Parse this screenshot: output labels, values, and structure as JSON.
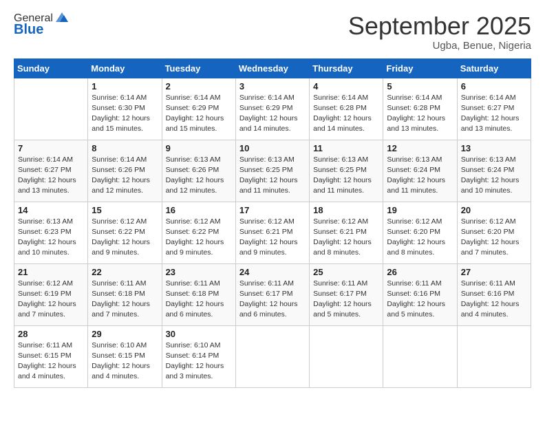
{
  "logo": {
    "general": "General",
    "blue": "Blue"
  },
  "header": {
    "month": "September 2025",
    "location": "Ugba, Benue, Nigeria"
  },
  "days_of_week": [
    "Sunday",
    "Monday",
    "Tuesday",
    "Wednesday",
    "Thursday",
    "Friday",
    "Saturday"
  ],
  "weeks": [
    [
      {
        "day": "",
        "sunrise": "",
        "sunset": "",
        "daylight": ""
      },
      {
        "day": "1",
        "sunrise": "Sunrise: 6:14 AM",
        "sunset": "Sunset: 6:30 PM",
        "daylight": "Daylight: 12 hours and 15 minutes."
      },
      {
        "day": "2",
        "sunrise": "Sunrise: 6:14 AM",
        "sunset": "Sunset: 6:29 PM",
        "daylight": "Daylight: 12 hours and 15 minutes."
      },
      {
        "day": "3",
        "sunrise": "Sunrise: 6:14 AM",
        "sunset": "Sunset: 6:29 PM",
        "daylight": "Daylight: 12 hours and 14 minutes."
      },
      {
        "day": "4",
        "sunrise": "Sunrise: 6:14 AM",
        "sunset": "Sunset: 6:28 PM",
        "daylight": "Daylight: 12 hours and 14 minutes."
      },
      {
        "day": "5",
        "sunrise": "Sunrise: 6:14 AM",
        "sunset": "Sunset: 6:28 PM",
        "daylight": "Daylight: 12 hours and 13 minutes."
      },
      {
        "day": "6",
        "sunrise": "Sunrise: 6:14 AM",
        "sunset": "Sunset: 6:27 PM",
        "daylight": "Daylight: 12 hours and 13 minutes."
      }
    ],
    [
      {
        "day": "7",
        "sunrise": "Sunrise: 6:14 AM",
        "sunset": "Sunset: 6:27 PM",
        "daylight": "Daylight: 12 hours and 13 minutes."
      },
      {
        "day": "8",
        "sunrise": "Sunrise: 6:14 AM",
        "sunset": "Sunset: 6:26 PM",
        "daylight": "Daylight: 12 hours and 12 minutes."
      },
      {
        "day": "9",
        "sunrise": "Sunrise: 6:13 AM",
        "sunset": "Sunset: 6:26 PM",
        "daylight": "Daylight: 12 hours and 12 minutes."
      },
      {
        "day": "10",
        "sunrise": "Sunrise: 6:13 AM",
        "sunset": "Sunset: 6:25 PM",
        "daylight": "Daylight: 12 hours and 11 minutes."
      },
      {
        "day": "11",
        "sunrise": "Sunrise: 6:13 AM",
        "sunset": "Sunset: 6:25 PM",
        "daylight": "Daylight: 12 hours and 11 minutes."
      },
      {
        "day": "12",
        "sunrise": "Sunrise: 6:13 AM",
        "sunset": "Sunset: 6:24 PM",
        "daylight": "Daylight: 12 hours and 11 minutes."
      },
      {
        "day": "13",
        "sunrise": "Sunrise: 6:13 AM",
        "sunset": "Sunset: 6:24 PM",
        "daylight": "Daylight: 12 hours and 10 minutes."
      }
    ],
    [
      {
        "day": "14",
        "sunrise": "Sunrise: 6:13 AM",
        "sunset": "Sunset: 6:23 PM",
        "daylight": "Daylight: 12 hours and 10 minutes."
      },
      {
        "day": "15",
        "sunrise": "Sunrise: 6:12 AM",
        "sunset": "Sunset: 6:22 PM",
        "daylight": "Daylight: 12 hours and 9 minutes."
      },
      {
        "day": "16",
        "sunrise": "Sunrise: 6:12 AM",
        "sunset": "Sunset: 6:22 PM",
        "daylight": "Daylight: 12 hours and 9 minutes."
      },
      {
        "day": "17",
        "sunrise": "Sunrise: 6:12 AM",
        "sunset": "Sunset: 6:21 PM",
        "daylight": "Daylight: 12 hours and 9 minutes."
      },
      {
        "day": "18",
        "sunrise": "Sunrise: 6:12 AM",
        "sunset": "Sunset: 6:21 PM",
        "daylight": "Daylight: 12 hours and 8 minutes."
      },
      {
        "day": "19",
        "sunrise": "Sunrise: 6:12 AM",
        "sunset": "Sunset: 6:20 PM",
        "daylight": "Daylight: 12 hours and 8 minutes."
      },
      {
        "day": "20",
        "sunrise": "Sunrise: 6:12 AM",
        "sunset": "Sunset: 6:20 PM",
        "daylight": "Daylight: 12 hours and 7 minutes."
      }
    ],
    [
      {
        "day": "21",
        "sunrise": "Sunrise: 6:12 AM",
        "sunset": "Sunset: 6:19 PM",
        "daylight": "Daylight: 12 hours and 7 minutes."
      },
      {
        "day": "22",
        "sunrise": "Sunrise: 6:11 AM",
        "sunset": "Sunset: 6:18 PM",
        "daylight": "Daylight: 12 hours and 7 minutes."
      },
      {
        "day": "23",
        "sunrise": "Sunrise: 6:11 AM",
        "sunset": "Sunset: 6:18 PM",
        "daylight": "Daylight: 12 hours and 6 minutes."
      },
      {
        "day": "24",
        "sunrise": "Sunrise: 6:11 AM",
        "sunset": "Sunset: 6:17 PM",
        "daylight": "Daylight: 12 hours and 6 minutes."
      },
      {
        "day": "25",
        "sunrise": "Sunrise: 6:11 AM",
        "sunset": "Sunset: 6:17 PM",
        "daylight": "Daylight: 12 hours and 5 minutes."
      },
      {
        "day": "26",
        "sunrise": "Sunrise: 6:11 AM",
        "sunset": "Sunset: 6:16 PM",
        "daylight": "Daylight: 12 hours and 5 minutes."
      },
      {
        "day": "27",
        "sunrise": "Sunrise: 6:11 AM",
        "sunset": "Sunset: 6:16 PM",
        "daylight": "Daylight: 12 hours and 4 minutes."
      }
    ],
    [
      {
        "day": "28",
        "sunrise": "Sunrise: 6:11 AM",
        "sunset": "Sunset: 6:15 PM",
        "daylight": "Daylight: 12 hours and 4 minutes."
      },
      {
        "day": "29",
        "sunrise": "Sunrise: 6:10 AM",
        "sunset": "Sunset: 6:15 PM",
        "daylight": "Daylight: 12 hours and 4 minutes."
      },
      {
        "day": "30",
        "sunrise": "Sunrise: 6:10 AM",
        "sunset": "Sunset: 6:14 PM",
        "daylight": "Daylight: 12 hours and 3 minutes."
      },
      {
        "day": "",
        "sunrise": "",
        "sunset": "",
        "daylight": ""
      },
      {
        "day": "",
        "sunrise": "",
        "sunset": "",
        "daylight": ""
      },
      {
        "day": "",
        "sunrise": "",
        "sunset": "",
        "daylight": ""
      },
      {
        "day": "",
        "sunrise": "",
        "sunset": "",
        "daylight": ""
      }
    ]
  ]
}
